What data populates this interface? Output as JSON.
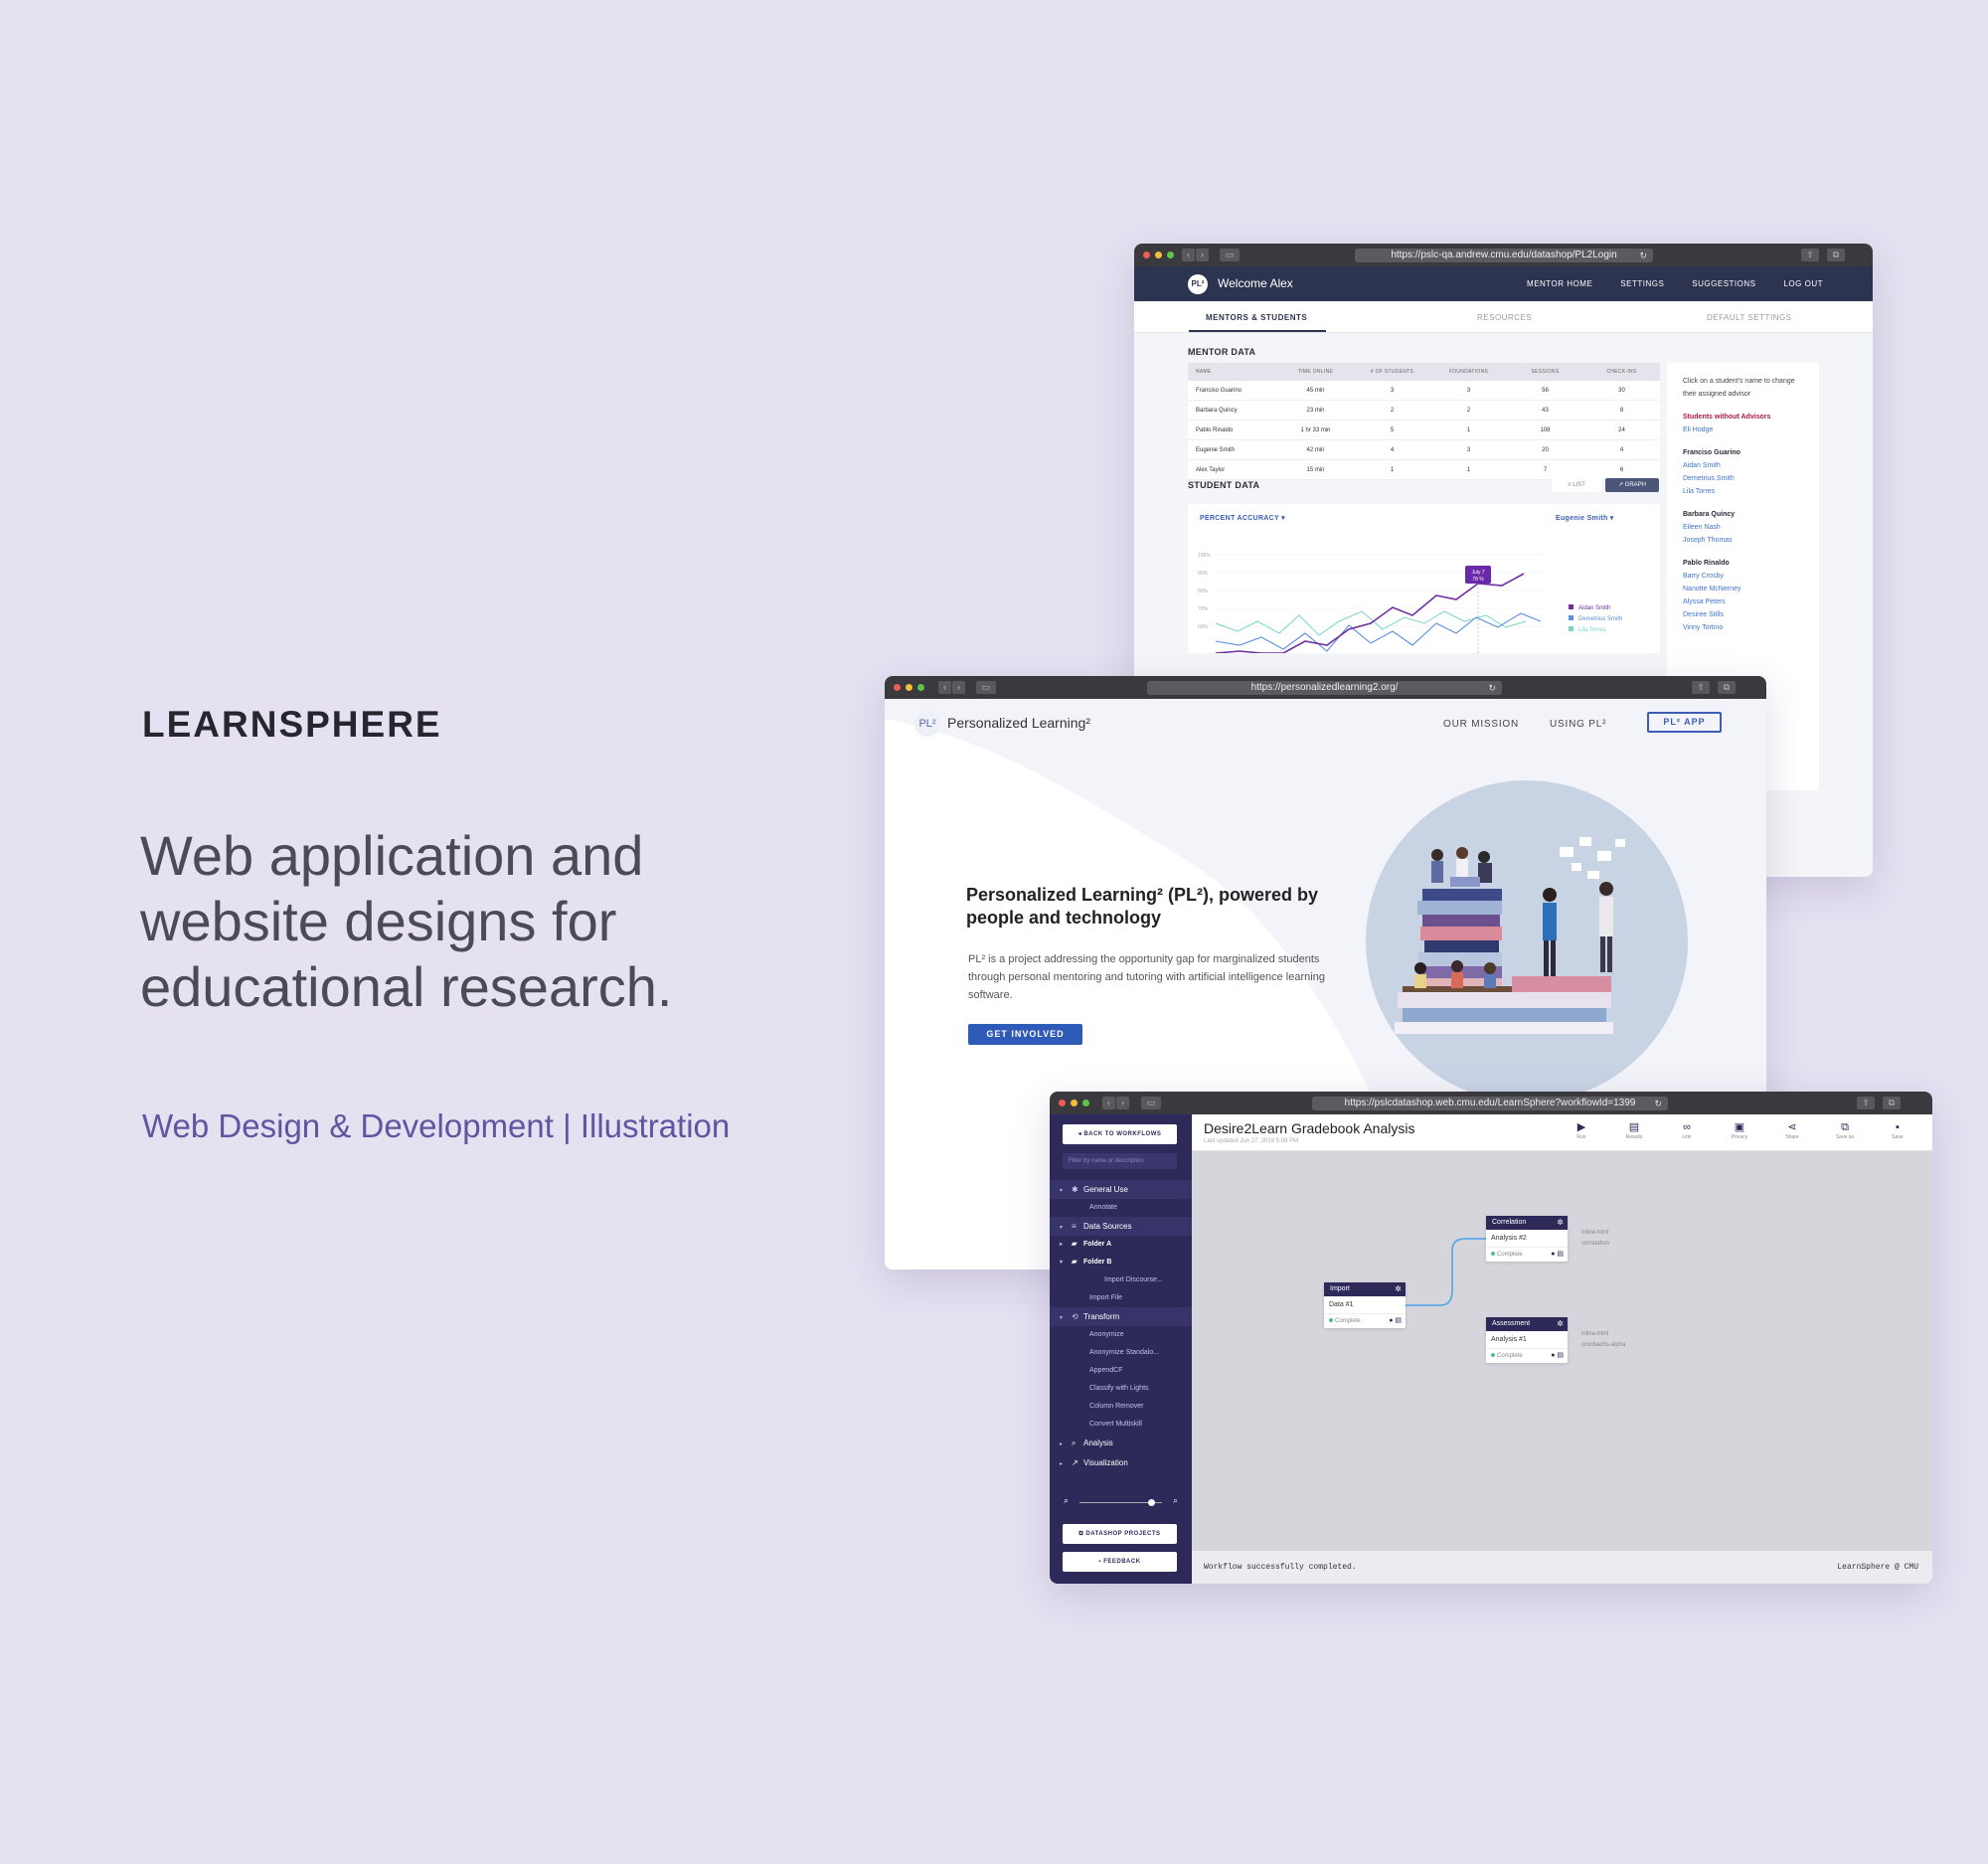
{
  "left": {
    "brand": "LEARNSPHERE",
    "tagline": "Web application and website designs for educational research.",
    "services": "Web Design & Development | Illustration"
  },
  "win1": {
    "url": "https://pslc-qa.andrew.cmu.edu/datashop/PL2Login",
    "logo": "PL²",
    "welcome": "Welcome Alex",
    "nav": [
      "MENTOR HOME",
      "SETTINGS",
      "SUGGESTIONS",
      "LOG OUT"
    ],
    "tabs": [
      "MENTORS & STUDENTS",
      "RESOURCES",
      "DEFAULT SETTINGS"
    ],
    "mentor_title": "MENTOR DATA",
    "mentor_columns": [
      "NAME",
      "TIME ONLINE",
      "# OF STUDENTS",
      "FOUNDATIONS",
      "SESSIONS",
      "CHECK-INS"
    ],
    "mentor_rows": [
      [
        "Franciso Guarino",
        "45 min",
        "3",
        "3",
        "56",
        "30"
      ],
      [
        "Barbara Quincy",
        "23 min",
        "2",
        "2",
        "43",
        "8"
      ],
      [
        "Pablo Rinaldo",
        "1 hr 33 min",
        "5",
        "1",
        "108",
        "24"
      ],
      [
        "Eugenie Smith",
        "42 min",
        "4",
        "3",
        "20",
        "4"
      ],
      [
        "Alex Taylor",
        "15 min",
        "1",
        "1",
        "7",
        "6"
      ]
    ],
    "student_title": "STUDENT DATA",
    "toggle_list": "LIST",
    "toggle_graph": "GRAPH",
    "metric_dropdown": "PERCENT ACCURACY",
    "student_dropdown": "Eugenie Smith",
    "chart_yticks": [
      "100%",
      "90%",
      "80%",
      "70%",
      "60%"
    ],
    "chart_tooltip": [
      "July 7",
      "78 %"
    ],
    "legend": [
      "Aidan Smith",
      "Demetrius Smith",
      "Lila Torres"
    ],
    "advisor_help": "Click on a student's name to change their assigned advisor",
    "no_advisor_title": "Students without Advisors",
    "no_advisor": [
      "Eli Hodge"
    ],
    "groups": [
      {
        "mentor": "Franciso Guarino",
        "students": [
          "Aidan Smith",
          "Demetrius Smith",
          "Lila Torres"
        ]
      },
      {
        "mentor": "Barbara Quincy",
        "students": [
          "Eileen Nash",
          "Joseph Thomas"
        ]
      },
      {
        "mentor": "Pablo Rinaldo",
        "students": [
          "Barry Crosby",
          "Nanotte McNerney",
          "Alyssa Peters",
          "Desiree Stills",
          "Vinny Tortino"
        ]
      }
    ]
  },
  "win2": {
    "url": "https://personalizedlearning2.org/",
    "logo": "PL²",
    "brand": "Personalized Learning²",
    "nav": [
      "OUR MISSION",
      "USING PL²"
    ],
    "app_button": "PL² APP",
    "headline": "Personalized Learning² (PL²), powered by people and technology",
    "body": "PL² is a project addressing the opportunity gap for marginalized students through personal mentoring and tutoring with artificial intelligence learning software.",
    "cta": "GET INVOLVED"
  },
  "win3": {
    "url": "https://pslcdatashop.web.cmu.edu/LearnSphere?workflowId=1399",
    "back": "BACK TO WORKFLOWS",
    "filter_placeholder": "Filter by name or description",
    "groups": {
      "general": "General Use",
      "annotate": "Annotate",
      "data_sources": "Data Sources",
      "folder_a": "Folder A",
      "folder_b": "Folder B",
      "import_discourse": "Import Discourse...",
      "import_file": "Import File",
      "transform": "Transform",
      "transform_items": [
        "Anonymize",
        "Anonymize Standalo...",
        "AppendCF",
        "Classify with Lights",
        "Column Remover",
        "Convert Multiskill"
      ],
      "analysis": "Analysis",
      "visualization": "Visualization"
    },
    "datashop_btn": "DATASHOP PROJECTS",
    "feedback_btn": "FEEDBACK",
    "title": "Desire2Learn Gradebook Analysis",
    "updated": "Last updated Jun 27, 2019 5:08 PM",
    "tools": [
      "Run",
      "Results",
      "Link",
      "Privacy",
      "Share",
      "Save as",
      "Save"
    ],
    "nodes": {
      "import": {
        "head": "Import",
        "body": "Data #1",
        "status": "Complete"
      },
      "correlation": {
        "head": "Correlation",
        "body": "Analysis #2",
        "status": "Complete",
        "outputs": [
          "inline-html",
          "correlation"
        ]
      },
      "assessment": {
        "head": "Assessment",
        "body": "Analysis #1",
        "status": "Complete",
        "outputs": [
          "inline-html",
          "cronbachs-alpha"
        ]
      }
    },
    "status_msg": "Workflow successfully completed.",
    "footer_right": "LearnSphere @ CMU"
  }
}
